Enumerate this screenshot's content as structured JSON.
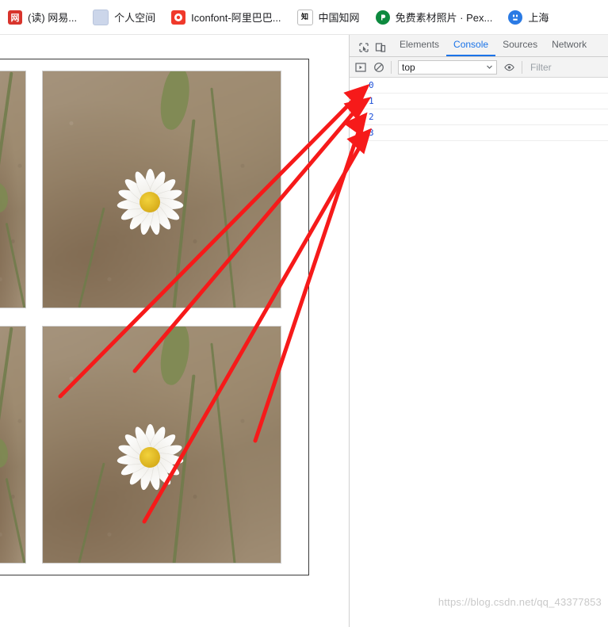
{
  "bookmarks": [
    {
      "label": "(读) 网易...",
      "icon": "netease-icon"
    },
    {
      "label": "个人空间",
      "icon": "personal-space-icon"
    },
    {
      "label": "Iconfont-阿里巴巴...",
      "icon": "iconfont-icon"
    },
    {
      "label": "中国知网",
      "icon": "cnki-icon"
    },
    {
      "label": "免费素材照片 · Pex...",
      "icon": "pexels-icon"
    },
    {
      "label": "上海",
      "icon": "baidu-icon"
    }
  ],
  "devtools": {
    "tabs": [
      {
        "label": "Elements",
        "active": false
      },
      {
        "label": "Console",
        "active": true
      },
      {
        "label": "Sources",
        "active": false
      },
      {
        "label": "Network",
        "active": false
      }
    ],
    "toolbar": {
      "inspect_icon": "inspect-element-icon",
      "device_icon": "device-toolbar-icon",
      "execute_icon": "execute-script-icon",
      "clear_icon": "clear-console-icon",
      "context": "top",
      "context_caret": "chevron-down-icon",
      "eye_icon": "live-expression-icon",
      "filter_placeholder": "Filter"
    },
    "console_logs": [
      "0",
      "1",
      "2",
      "3"
    ]
  },
  "page": {
    "photos": [
      {
        "alt": "daisy flower photo",
        "position": "top-left-cropped"
      },
      {
        "alt": "daisy flower photo",
        "position": "top-right"
      },
      {
        "alt": "daisy flower photo",
        "position": "bottom-left-cropped"
      },
      {
        "alt": "daisy flower photo",
        "position": "bottom-right"
      }
    ]
  },
  "annotations": {
    "arrow_color": "#f61a1a",
    "arrow_count": 4,
    "description": "red arrows pointing from images to console log entries"
  },
  "watermark": "https://blog.csdn.net/qq_43377853",
  "colors": {
    "accent": "#1a73e8",
    "log_text": "#1a4ed8",
    "annotation": "#f61a1a",
    "devtools_bg": "#f3f3f3"
  }
}
